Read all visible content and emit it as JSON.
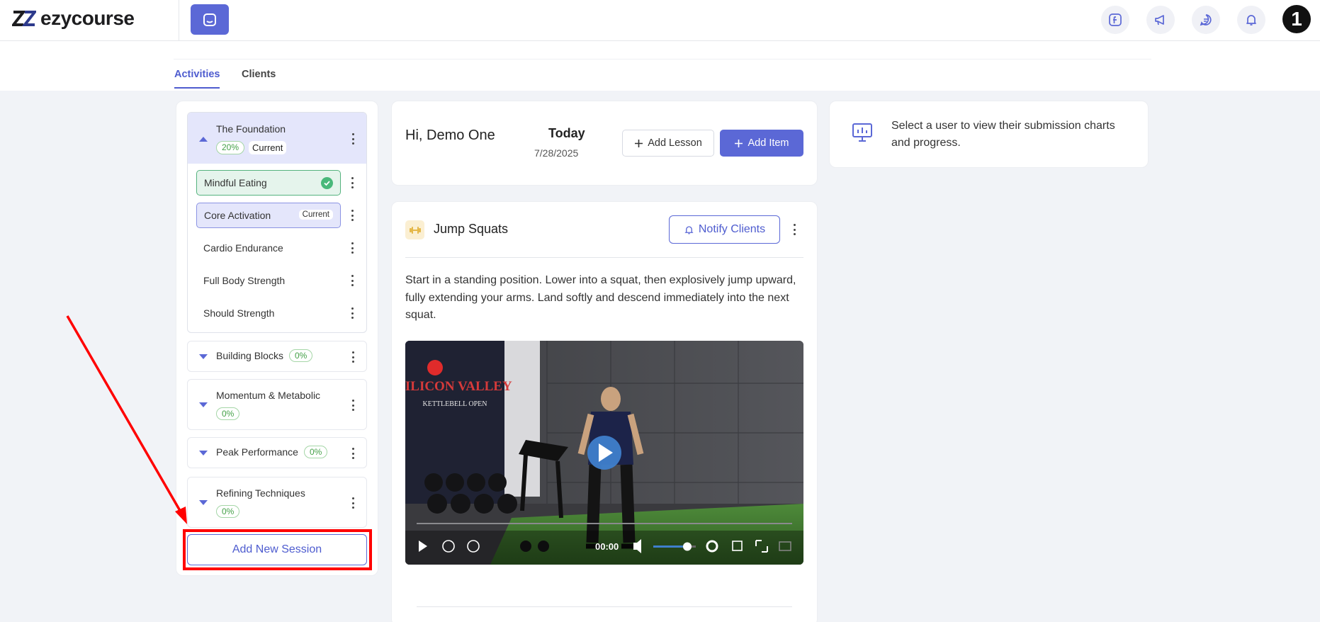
{
  "app": {
    "logo_text": "ezycourse"
  },
  "header": {
    "icons": [
      "facebook-icon",
      "megaphone-icon",
      "chat-icon",
      "bell-icon"
    ],
    "avatar_text": "1"
  },
  "tabs": [
    {
      "label": "Activities",
      "active": true
    },
    {
      "label": "Clients",
      "active": false
    }
  ],
  "sessions": {
    "open": {
      "title": "The Foundation",
      "percent": "20%",
      "badge": "Current"
    },
    "lessons": [
      {
        "label": "Mindful Eating",
        "state": "done"
      },
      {
        "label": "Core Activation",
        "state": "current",
        "badge": "Current"
      },
      {
        "label": "Cardio Endurance",
        "state": "normal"
      },
      {
        "label": "Full Body Strength",
        "state": "normal"
      },
      {
        "label": "Should Strength",
        "state": "normal"
      }
    ],
    "collapsed": [
      {
        "title": "Building Blocks",
        "percent": "0%"
      },
      {
        "title": "Momentum & Metabolic",
        "percent": "0%"
      },
      {
        "title": "Peak Performance",
        "percent": "0%"
      },
      {
        "title": "Refining Techniques",
        "percent": "0%"
      }
    ],
    "add_label": "Add New Session"
  },
  "greeting": {
    "text": "Hi, Demo One",
    "today": "Today",
    "date": "7/28/2025",
    "add_lesson": "Add Lesson",
    "add_item": "Add Item"
  },
  "item": {
    "title": "Jump Squats",
    "notify": "Notify Clients",
    "description": "Start in a standing position. Lower into a squat, then explosively jump upward, fully extending your arms. Land softly and descend immediately into the next squat.",
    "video": {
      "time": "00:00",
      "banner_line1": "SILICON VALLEY",
      "banner_line2": "KETTLEBELL OPEN",
      "volume_level": 0.8
    }
  },
  "right_panel": {
    "text": "Select a user to view their submission charts and progress."
  },
  "colors": {
    "accent": "#5b68d6",
    "success": "#49b87a",
    "highlight": "#ff0000"
  }
}
